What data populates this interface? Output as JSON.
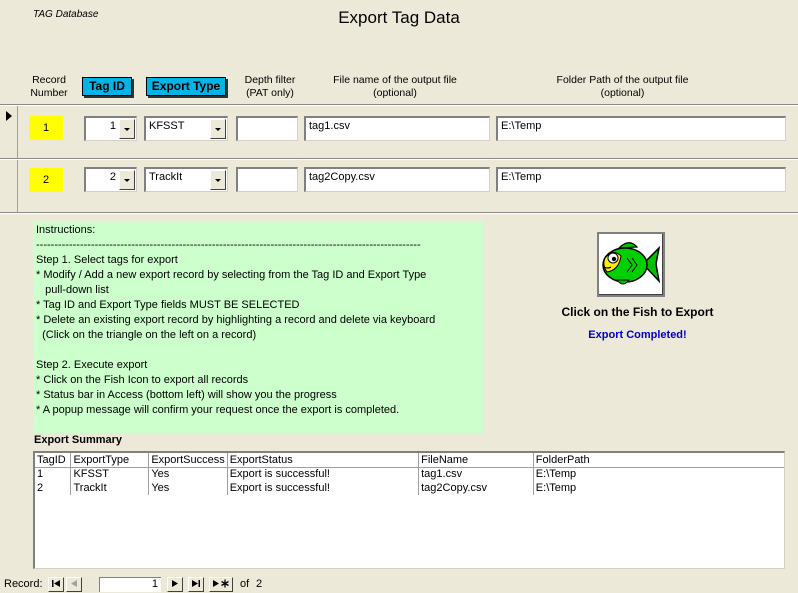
{
  "app_name": "TAG Database",
  "title": "Export Tag Data",
  "headers": {
    "record_number": "Record\nNumber",
    "tag_id": "Tag ID",
    "export_type": "Export Type",
    "depth_filter": "Depth filter\n(PAT only)",
    "file_name": "File name of the output file\n(optional)",
    "folder_path": "Folder Path of the output file\n(optional)"
  },
  "records": [
    {
      "number": "1",
      "tag_id": "1",
      "export_type": "KFSST",
      "depth_filter": "",
      "file_name": "tag1.csv",
      "folder_path": "E:\\Temp"
    },
    {
      "number": "2",
      "tag_id": "2",
      "export_type": "TrackIt",
      "depth_filter": "",
      "file_name": "tag2Copy.csv",
      "folder_path": "E:\\Temp"
    }
  ],
  "instructions": "Instructions:\n---------------------------------------------------------------------------------------------------------\nStep 1. Select tags for export\n* Modify / Add a new export record by selecting from the Tag ID and Export Type\n   pull-down list\n* Tag ID and Export Type fields MUST BE SELECTED\n* Delete an existing export record by highlighting a record and delete via keyboard\n  (Click on the triangle on the left on a record)\n\nStep 2. Execute export\n* Click on the Fish Icon to export all records\n* Status bar in Access (bottom left) will show you the progress\n* A popup message will confirm your request once the export is completed.",
  "fish_caption": "Click on the Fish to Export",
  "status_message": "Export Completed!",
  "summary": {
    "title": "Export Summary",
    "columns": [
      "TagID",
      "ExportType",
      "ExportSuccess",
      "ExportStatus",
      "FileName",
      "FolderPath"
    ],
    "rows": [
      [
        "1",
        "KFSST",
        "Yes",
        "Export is successful!",
        "tag1.csv",
        "E:\\Temp"
      ],
      [
        "2",
        "TrackIt",
        "Yes",
        "Export is successful!",
        "tag2Copy.csv",
        "E:\\Temp"
      ]
    ]
  },
  "nav": {
    "label": "Record:",
    "current": "1",
    "of_label": "of",
    "total": "2"
  },
  "colors": {
    "background": "#ece9d8",
    "header_button": "#00b4e8",
    "record_number": "#ffff00",
    "instructions_bg": "#ccffcc",
    "status_text": "#0000c8"
  },
  "icons": {
    "fish": "fish-icon",
    "combo": "chevron-down-icon",
    "selector": "record-selector-icon"
  }
}
